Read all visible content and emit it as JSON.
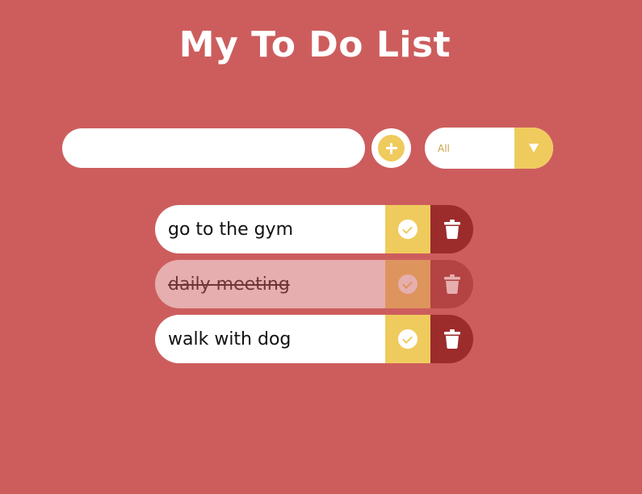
{
  "header": {
    "title": "My To Do List"
  },
  "form": {
    "input_value": "",
    "input_placeholder": "",
    "filter_selected": "All"
  },
  "todos": [
    {
      "text": "go to the gym",
      "completed": false
    },
    {
      "text": "daily meeting",
      "completed": true
    },
    {
      "text": "walk with dog",
      "completed": false
    }
  ],
  "colors": {
    "background": "#cd5d5d",
    "accent": "#efcb5e",
    "delete": "#9c2b2b",
    "surface": "#ffffff"
  },
  "icons": {
    "add": "plus-circle-icon",
    "filter": "caret-down-icon",
    "complete": "check-circle-icon",
    "delete": "trash-icon"
  }
}
